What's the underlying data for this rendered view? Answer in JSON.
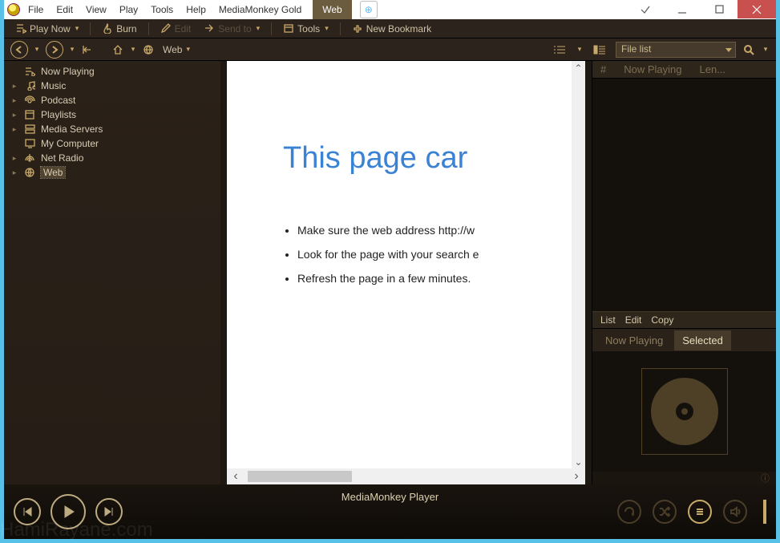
{
  "titlebar": {
    "menus": [
      "File",
      "Edit",
      "View",
      "Play",
      "Tools",
      "Help",
      "MediaMonkey Gold"
    ],
    "active_tab": "Web"
  },
  "toolbar1": {
    "play_now": "Play Now",
    "burn": "Burn",
    "edit": "Edit",
    "send_to": "Send to",
    "tools": "Tools",
    "new_bookmark": "New Bookmark"
  },
  "toolbar2": {
    "home_label": "",
    "crumb1": "Web",
    "filelist": "File list"
  },
  "tree": {
    "items": [
      {
        "label": "Now Playing",
        "expand": "",
        "icon": "nowplaying"
      },
      {
        "label": "Music",
        "expand": "▸",
        "icon": "music"
      },
      {
        "label": "Podcast",
        "expand": "▸",
        "icon": "podcast"
      },
      {
        "label": "Playlists",
        "expand": "▸",
        "icon": "playlist"
      },
      {
        "label": "Media Servers",
        "expand": "▸",
        "icon": "server"
      },
      {
        "label": "My Computer",
        "expand": "",
        "icon": "computer"
      },
      {
        "label": "Net Radio",
        "expand": "▸",
        "icon": "radio"
      },
      {
        "label": "Web",
        "expand": "▸",
        "icon": "web",
        "selected": true
      }
    ]
  },
  "web": {
    "heading": "This page car",
    "bullets": [
      "Make sure the web address http://w",
      "Look for the page with your search e",
      "Refresh the page in a few minutes."
    ]
  },
  "listhead": {
    "col0": "#",
    "col1": "Now Playing",
    "col2": "Len..."
  },
  "panelmenu": {
    "i0": "List",
    "i1": "Edit",
    "i2": "Copy"
  },
  "paneltabs": {
    "t0": "Now Playing",
    "t1": "Selected"
  },
  "player": {
    "title": "MediaMonkey Player"
  },
  "subinfo": "ⓘ",
  "watermark": "HamiRayane.com"
}
